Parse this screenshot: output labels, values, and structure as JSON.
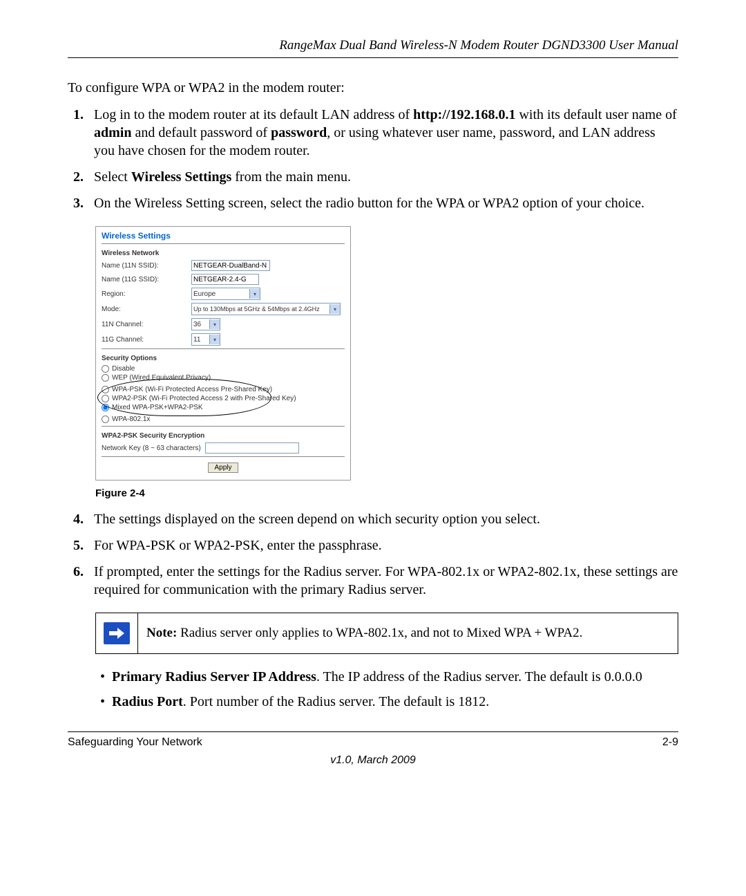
{
  "header": "RangeMax Dual Band Wireless-N Modem Router DGND3300 User Manual",
  "intro": "To configure WPA or WPA2 in the modem router:",
  "steps": {
    "s1_a": "Log in to the modem router at its default LAN address of ",
    "s1_url": "http://192.168.0.1",
    "s1_b": " with its default user name of ",
    "s1_admin": "admin",
    "s1_c": " and default password of ",
    "s1_pwd": "password",
    "s1_d": ", or using whatever user name, password, and LAN address you have chosen for the modem router.",
    "s2_a": "Select ",
    "s2_bold": "Wireless Settings",
    "s2_b": " from the main menu.",
    "s3": "On the Wireless Setting screen, select the radio button for the WPA or WPA2 option of your choice.",
    "s4": "The settings displayed on the screen depend on which security option you select.",
    "s5": "For WPA-PSK or WPA2-PSK, enter the passphrase.",
    "s6": "If prompted, enter the settings for the Radius server. For WPA-802.1x or WPA2-802.1x, these settings are required for communication with the primary Radius server."
  },
  "panel": {
    "title": "Wireless Settings",
    "wn_head": "Wireless Network",
    "name11n_lbl": "Name (11N SSID):",
    "name11n_val": "NETGEAR-DualBand-N",
    "name11g_lbl": "Name (11G SSID):",
    "name11g_val": "NETGEAR-2.4-G",
    "region_lbl": "Region:",
    "region_val": "Europe",
    "mode_lbl": "Mode:",
    "mode_val": "Up to 130Mbps at 5GHz & 54Mbps at 2.4GHz",
    "ch11n_lbl": "11N Channel:",
    "ch11n_val": "36",
    "ch11g_lbl": "11G Channel:",
    "ch11g_val": "11",
    "sec_head": "Security Options",
    "opt_disable": "Disable",
    "opt_wep": "WEP (Wired Equivalent Privacy)",
    "opt_wpapsk": "WPA-PSK (Wi-Fi Protected Access Pre-Shared Key)",
    "opt_wpa2psk": "WPA2-PSK (Wi-Fi Protected Access 2 with Pre-Shared Key)",
    "opt_mixed": "Mixed WPA-PSK+WPA2-PSK",
    "opt_8021x": "WPA-802.1x",
    "enc_head": "WPA2-PSK Security Encryption",
    "netkey_lbl": "Network Key (8 ~ 63 characters)",
    "apply": "Apply"
  },
  "fig_caption": "Figure 2-4",
  "note_lead": "Note:",
  "note_text": " Radius server only applies to WPA-802.1x, and not to Mixed WPA + WPA2.",
  "bullets": {
    "b1_bold": "Primary Radius Server IP Address",
    "b1_text": ". The IP address of the Radius server. The default is 0.0.0.0",
    "b2_bold": "Radius Port",
    "b2_text": ". Port number of the Radius server. The default is 1812."
  },
  "footer_left": "Safeguarding Your Network",
  "footer_right": "2-9",
  "version": "v1.0, March 2009"
}
